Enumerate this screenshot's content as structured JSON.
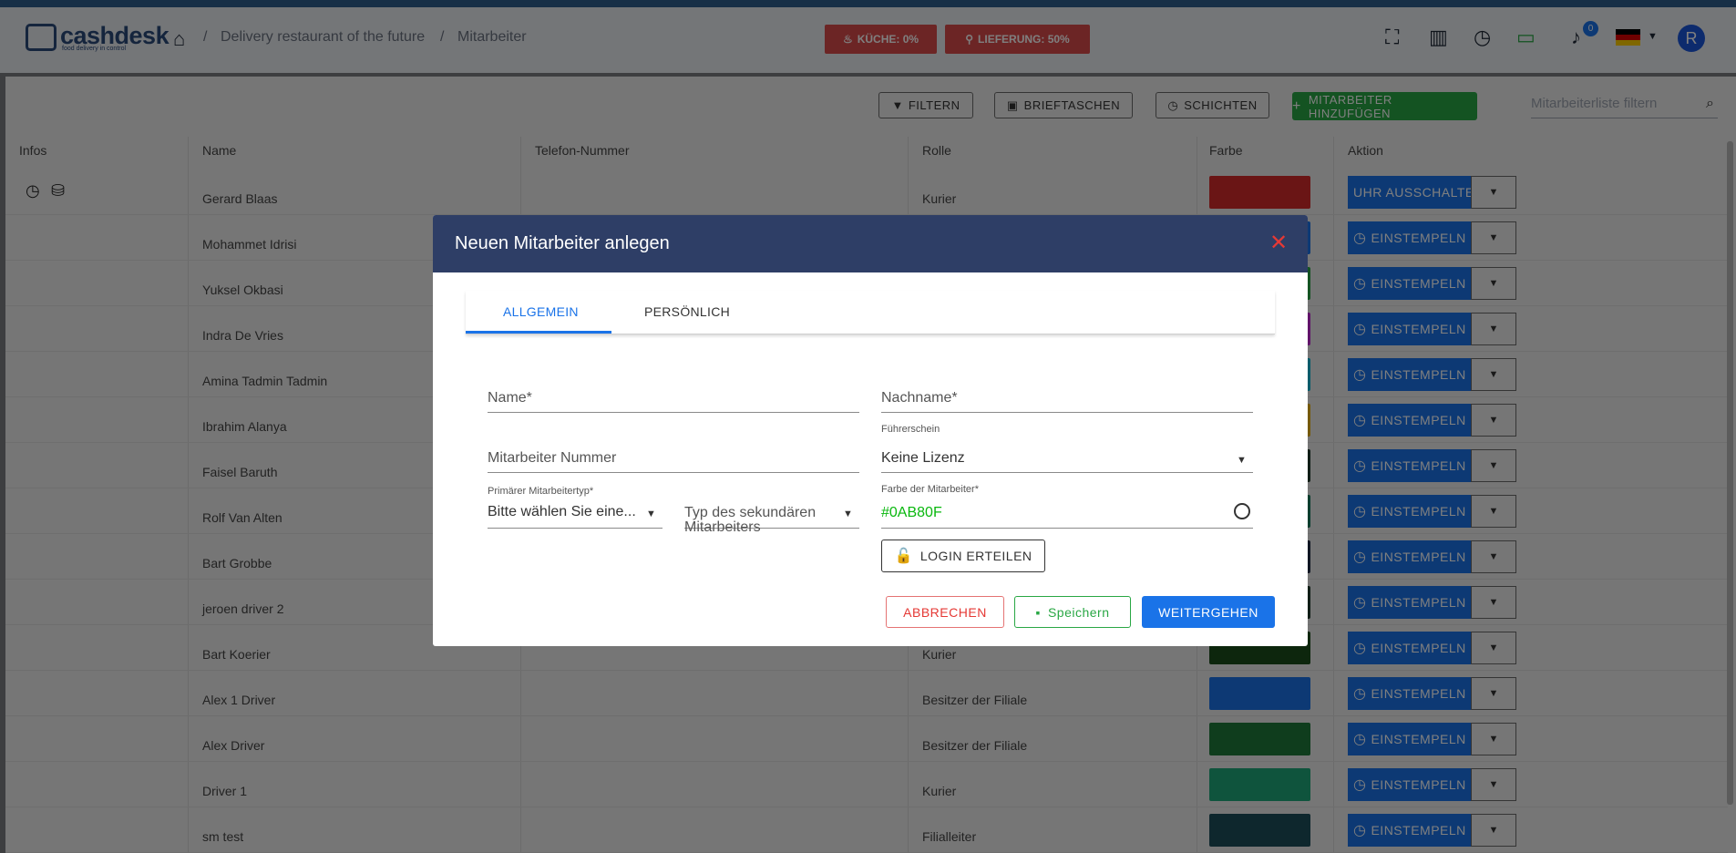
{
  "app": {
    "logo_brand": "cashdesk",
    "logo_tagline": "food delivery in control",
    "breadcrumb": [
      "Delivery restaurant of the future",
      "Mitarbeiter"
    ],
    "status_kitchen": "KÜCHE: 0%",
    "status_delivery": "LIEFERUNG: 50%",
    "notifications_count": "0",
    "avatar_initial": "R"
  },
  "toolbar": {
    "filter_label": "FILTERN",
    "wallets_label": "BRIEFTASCHEN",
    "shifts_label": "SCHICHTEN",
    "add_label": "MITARBEITER HINZUFÜGEN",
    "search_placeholder": "Mitarbeiterliste filtern"
  },
  "table": {
    "headers": [
      "Infos",
      "Name",
      "Telefon-Nummer",
      "Rolle",
      "Farbe",
      "Aktion"
    ],
    "rows": [
      {
        "name": "Gerard Blaas",
        "role": "Kurier",
        "color": "#d42a2a",
        "action": "UHR AUSSCHALTEN"
      },
      {
        "name": "Mohammet Idrisi",
        "role": "",
        "color": "#1a73e8",
        "action": "EINSTEMPELN"
      },
      {
        "name": "Yuksel Okbasi",
        "role": "",
        "color": "#29a744",
        "action": "EINSTEMPELN"
      },
      {
        "name": "Indra De Vries",
        "role": "",
        "color": "#c026d3",
        "action": "EINSTEMPELN"
      },
      {
        "name": "Amina Tadmin Tadmin",
        "role": "",
        "color": "#06b6d4",
        "action": "EINSTEMPELN"
      },
      {
        "name": "Ibrahim Alanya",
        "role": "",
        "color": "#eab308",
        "action": "EINSTEMPELN"
      },
      {
        "name": "Faisel Baruth",
        "role": "",
        "color": "#1f3b2b",
        "action": "EINSTEMPELN"
      },
      {
        "name": "Rolf Van Alten",
        "role": "",
        "color": "#0e7a5a",
        "action": "EINSTEMPELN"
      },
      {
        "name": "Bart Grobbe",
        "role": "",
        "color": "#1e2a44",
        "action": "EINSTEMPELN"
      },
      {
        "name": "jeroen driver 2",
        "role": "",
        "color": "#1f3b2b",
        "action": "EINSTEMPELN"
      },
      {
        "name": "Bart Koerier",
        "role": "Kurier",
        "color": "#1b4d1b",
        "action": "EINSTEMPELN"
      },
      {
        "name": "Alex 1 Driver",
        "role": "Besitzer der Filiale",
        "color": "#1a73e8",
        "action": "EINSTEMPELN"
      },
      {
        "name": "Alex Driver",
        "role": "Besitzer der Filiale",
        "color": "#1e7a3a",
        "action": "EINSTEMPELN"
      },
      {
        "name": "Driver 1",
        "role": "Kurier",
        "color": "#1fa87a",
        "action": "EINSTEMPELN"
      },
      {
        "name": "sm test",
        "role": "Filialleiter",
        "color": "#1d4f5a",
        "action": "EINSTEMPELN"
      }
    ]
  },
  "modal": {
    "title": "Neuen Mitarbeiter anlegen",
    "tabs": [
      "ALLGEMEIN",
      "PERSÖNLICH"
    ],
    "name_label": "Name*",
    "lastname_label": "Nachname*",
    "number_label": "Mitarbeiter Nummer",
    "license_label": "Führerschein",
    "license_value": "Keine Lizenz",
    "primary_type_label": "Primärer Mitarbeitertyp*",
    "primary_type_value": "Bitte wählen Sie eine...",
    "secondary_type_label": "Typ des sekundären Mitarbeiters",
    "color_label": "Farbe der Mitarbeiter*",
    "color_value": "#0AB80F",
    "login_button": "LOGIN ERTEILEN",
    "cancel_button": "ABBRECHEN",
    "save_button": "Speichern",
    "continue_button": "WEITERGEHEN"
  }
}
